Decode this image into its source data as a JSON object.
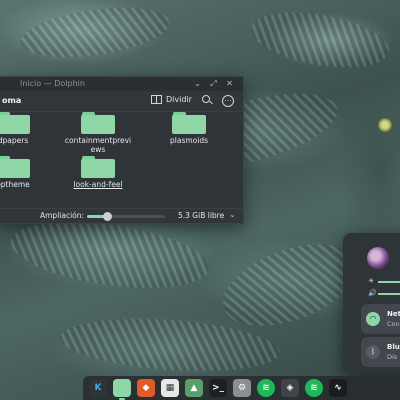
{
  "wallpaper": {
    "description_colors": {
      "rope_light": "#a6c3be",
      "rope_dark": "#344744"
    }
  },
  "file_manager": {
    "window_title": "Inicio — Dolphin",
    "breadcrumb": "oma",
    "split_label": "Dividir",
    "folders": [
      {
        "label": "dpapers",
        "underlined": false
      },
      {
        "label": "containmentpreviews",
        "underlined": false
      },
      {
        "label": "plasmoids",
        "underlined": false
      },
      {
        "label": "optheme",
        "underlined": false
      },
      {
        "label": "look-and-feel",
        "underlined": true
      }
    ],
    "zoom_label": "Ampliación:",
    "zoom_level": 0.25,
    "free_space": "5.3 GiB libre",
    "folder_color": "#8fd6a6"
  },
  "tray": {
    "brightness_level": 0.95,
    "volume_level": 0.95,
    "network": {
      "title": "Net",
      "subtitle": "Con"
    },
    "bluetooth": {
      "title": "Blue",
      "subtitle": "Dis"
    },
    "accent": "#8fd6a6"
  },
  "dock": {
    "items": [
      {
        "icon": "kde-icon",
        "color": "#2f3438"
      },
      {
        "icon": "file-manager-icon",
        "color": "#8fd6a6"
      },
      {
        "icon": "app-store-icon",
        "color": "#e05a2a"
      },
      {
        "icon": "package-icon",
        "color": "#e8e8e8"
      },
      {
        "icon": "image-viewer-icon",
        "color": "#5aa06a"
      },
      {
        "icon": "terminal-icon",
        "color": "#1d1f21"
      },
      {
        "icon": "settings-icon",
        "color": "#8b8f93"
      },
      {
        "icon": "spotify-icon",
        "color": "#1db954"
      },
      {
        "icon": "game-icon",
        "color": "#404448"
      },
      {
        "icon": "spotify-icon",
        "color": "#1db954"
      },
      {
        "icon": "system-monitor-icon",
        "color": "#1a1c1e"
      }
    ]
  }
}
